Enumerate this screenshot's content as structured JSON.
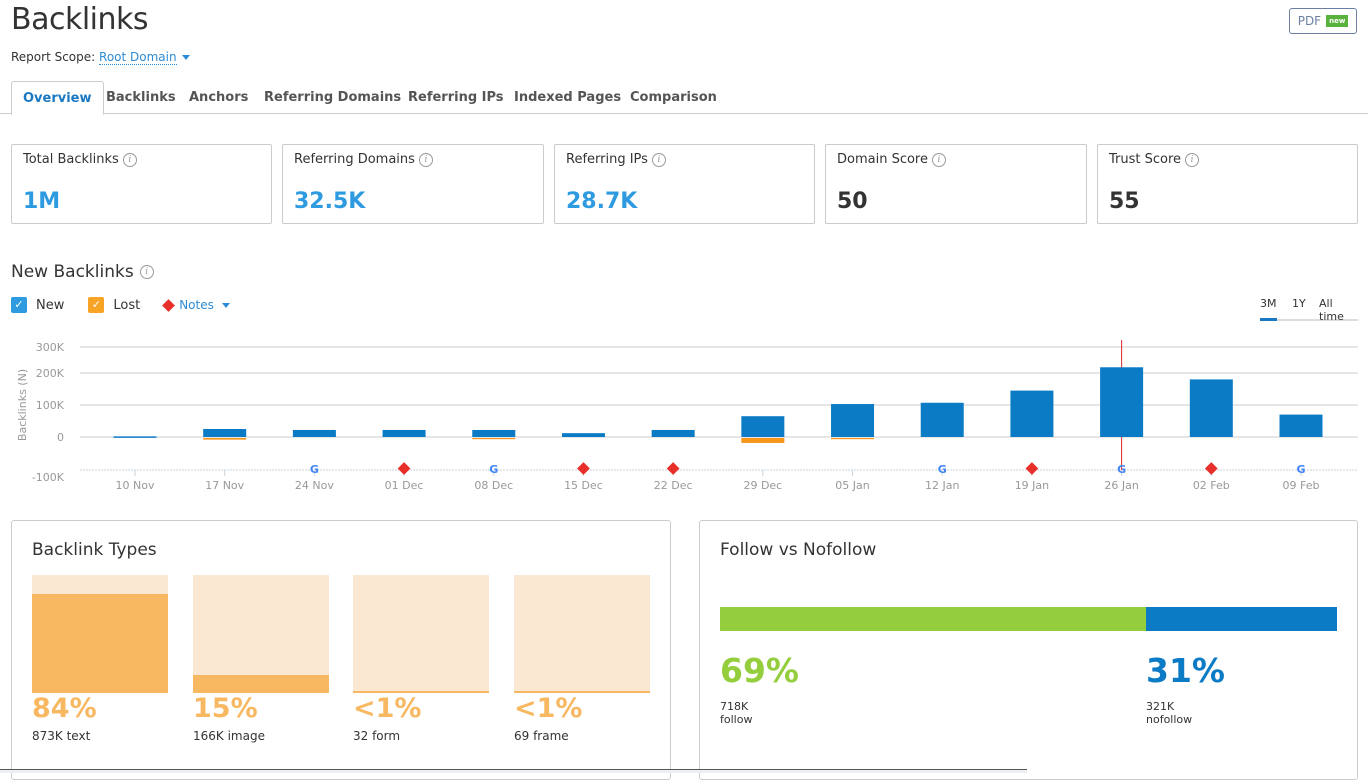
{
  "header": {
    "title": "Backlinks",
    "scope_label": "Report Scope:",
    "scope_value": "Root Domain",
    "pdf_label": "PDF",
    "pdf_badge": "new"
  },
  "tabs": [
    {
      "label": "Overview",
      "active": true
    },
    {
      "label": "Backlinks"
    },
    {
      "label": "Anchors"
    },
    {
      "label": "Referring Domains"
    },
    {
      "label": "Referring IPs"
    },
    {
      "label": "Indexed Pages"
    },
    {
      "label": "Comparison"
    }
  ],
  "metrics": [
    {
      "label": "Total Backlinks",
      "value": "1M"
    },
    {
      "label": "Referring Domains",
      "value": "32.5K"
    },
    {
      "label": "Referring IPs",
      "value": "28.7K"
    },
    {
      "label": "Domain Score",
      "value": "50"
    },
    {
      "label": "Trust Score",
      "value": "55"
    }
  ],
  "new_backlinks": {
    "title": "New Backlinks",
    "legend": {
      "new": "New",
      "lost": "Lost",
      "notes": "Notes"
    },
    "ranges": {
      "r3m": "3M",
      "r1y": "1Y",
      "all": "All time",
      "selected": "3M"
    }
  },
  "colors": {
    "new": "#0a7bc4",
    "lost": "#f7961c",
    "note": "#e8302b",
    "follow": "#95ce3c",
    "nofollow": "#0a7bc4",
    "type_fill": "#f8b862",
    "type_bg": "#fbe8d2"
  },
  "chart_data": {
    "type": "bar",
    "ylabel": "Backlinks (N)",
    "yticks": [
      "300K",
      "200K",
      "100K",
      "0",
      "-100K"
    ],
    "ytick_values": [
      300000,
      200000,
      100000,
      0,
      -100000
    ],
    "ylim": [
      -100000,
      300000
    ],
    "categories": [
      "10 Nov",
      "17 Nov",
      "24 Nov",
      "01 Dec",
      "08 Dec",
      "15 Dec",
      "22 Dec",
      "29 Dec",
      "05 Jan",
      "12 Jan",
      "19 Jan",
      "26 Jan",
      "02 Feb",
      "09 Feb"
    ],
    "series": [
      {
        "name": "New",
        "values": [
          2000,
          25000,
          22000,
          22000,
          22000,
          12000,
          22000,
          65000,
          103000,
          107000,
          145000,
          222000,
          180000,
          70000
        ]
      },
      {
        "name": "Lost",
        "values": [
          0,
          -8000,
          0,
          0,
          -3000,
          0,
          0,
          -18000,
          -2000,
          0,
          0,
          0,
          0,
          0
        ]
      }
    ],
    "markers": [
      "",
      "",
      "google",
      "note",
      "google",
      "note",
      "note",
      "",
      "",
      "google",
      "note",
      "google",
      "note",
      "google"
    ],
    "highlight_category": "26 Jan",
    "grid": true
  },
  "backlink_types": {
    "title": "Backlink Types",
    "items": [
      {
        "pct": "84%",
        "fraction": 0.84,
        "label": "873K text"
      },
      {
        "pct": "15%",
        "fraction": 0.15,
        "label": "166K image"
      },
      {
        "pct": "<1%",
        "fraction": 0.005,
        "label": "32 form"
      },
      {
        "pct": "<1%",
        "fraction": 0.005,
        "label": "69 frame"
      }
    ]
  },
  "follow_nofollow": {
    "title": "Follow vs Nofollow",
    "follow": {
      "pct": "69%",
      "fraction": 0.69,
      "count": "718K",
      "label": "follow"
    },
    "nofollow": {
      "pct": "31%",
      "fraction": 0.31,
      "count": "321K",
      "label": "nofollow"
    }
  }
}
